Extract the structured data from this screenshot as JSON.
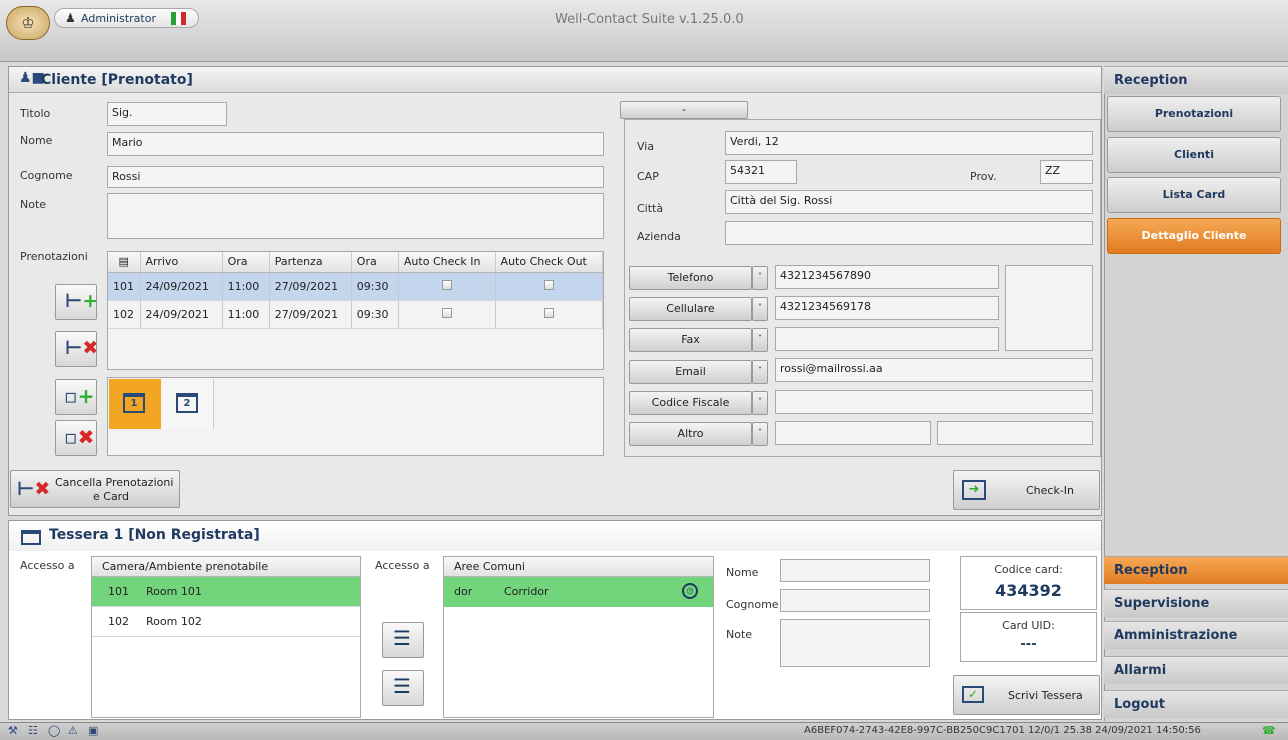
{
  "window": {
    "title": "Well-Contact Suite v.1.25.0.0",
    "user": "Administrator"
  },
  "cliente": {
    "header": "Cliente [Prenotato]",
    "labels": {
      "titolo": "Titolo",
      "nome": "Nome",
      "cognome": "Cognome",
      "note": "Note",
      "prenotazioni": "Prenotazioni"
    },
    "titolo": "Sig.",
    "nome": "Mario",
    "cognome": "Rossi",
    "note": ""
  },
  "prenotazioni": {
    "columns": [
      "Arrivo",
      "Ora",
      "Partenza",
      "Ora",
      "Auto Check In",
      "Auto Check Out"
    ],
    "rows": [
      {
        "room": "101",
        "arrivo": "24/09/2021",
        "ora1": "11:00",
        "partenza": "27/09/2021",
        "ora2": "09:30"
      },
      {
        "room": "102",
        "arrivo": "24/09/2021",
        "ora1": "11:00",
        "partenza": "27/09/2021",
        "ora2": "09:30"
      }
    ],
    "card_tabs": [
      "1",
      "2"
    ]
  },
  "address": {
    "tab_label": "-",
    "labels": {
      "via": "Via",
      "cap": "CAP",
      "prov": "Prov.",
      "citta": "Città",
      "azienda": "Azienda"
    },
    "via": "Verdi, 12",
    "cap": "54321",
    "prov": "ZZ",
    "citta": "Città del Sig. Rossi",
    "azienda": ""
  },
  "contacts": [
    {
      "label": "Telefono",
      "value": "4321234567890"
    },
    {
      "label": "Cellulare",
      "value": "4321234569178"
    },
    {
      "label": "Fax",
      "value": ""
    },
    {
      "label": "Email",
      "value": "rossi@mailrossi.aa"
    },
    {
      "label": "Codice Fiscale",
      "value": ""
    },
    {
      "label": "Altro",
      "value": ""
    }
  ],
  "actions": {
    "cancella_line1": "Cancella Prenotazioni",
    "cancella_line2": "e Card",
    "checkin": "Check-In",
    "scrivi": "Scrivi Tessera"
  },
  "tessera": {
    "header": "Tessera 1 [Non Registrata]",
    "accesso_label": "Accesso a",
    "camera_header": "Camera/Ambiente prenotabile",
    "rooms": [
      {
        "num": "101",
        "name": "Room 101"
      },
      {
        "num": "102",
        "name": "Room 102"
      }
    ],
    "aree_header": "Aree Comuni",
    "aree": [
      {
        "code": "dor",
        "name": "Corridor"
      }
    ],
    "labels": {
      "nome": "Nome",
      "cognome": "Cognome",
      "note": "Note"
    },
    "codice_label": "Codice card:",
    "codice_value": "434392",
    "uid_label": "Card UID:",
    "uid_value": "---"
  },
  "nav": {
    "section_top": "Reception",
    "items": [
      "Prenotazioni",
      "Clienti",
      "Lista Card",
      "Dettaglio Cliente"
    ],
    "sections": [
      "Reception",
      "Supervisione",
      "Amministrazione",
      "Allarmi",
      "Logout"
    ]
  },
  "status": {
    "text": "A6BEF074-2743-42E8-997C-BB250C9C1701 12/0/1 25.38 24/09/2021 14:50:56"
  }
}
